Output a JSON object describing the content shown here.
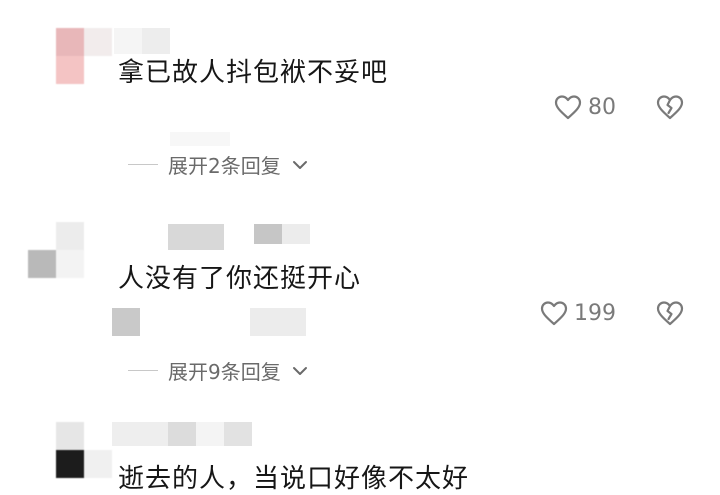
{
  "comments": [
    {
      "text": "拿已故人抖包袱不妥吧",
      "likes": "80",
      "expand_label": "展开2条回复"
    },
    {
      "text": "人没有了你还挺开心",
      "likes": "199",
      "expand_label": "展开9条回复"
    },
    {
      "text": "逝去的人，当说口好像不太好"
    }
  ],
  "colors": {
    "icon_gray": "#7a7a7a",
    "meta_gray": "#6a6a6a",
    "text_dark": "#161616"
  },
  "icons": {
    "like": "heart-outline-icon",
    "dislike": "broken-heart-icon",
    "expand": "chevron-down-icon"
  }
}
